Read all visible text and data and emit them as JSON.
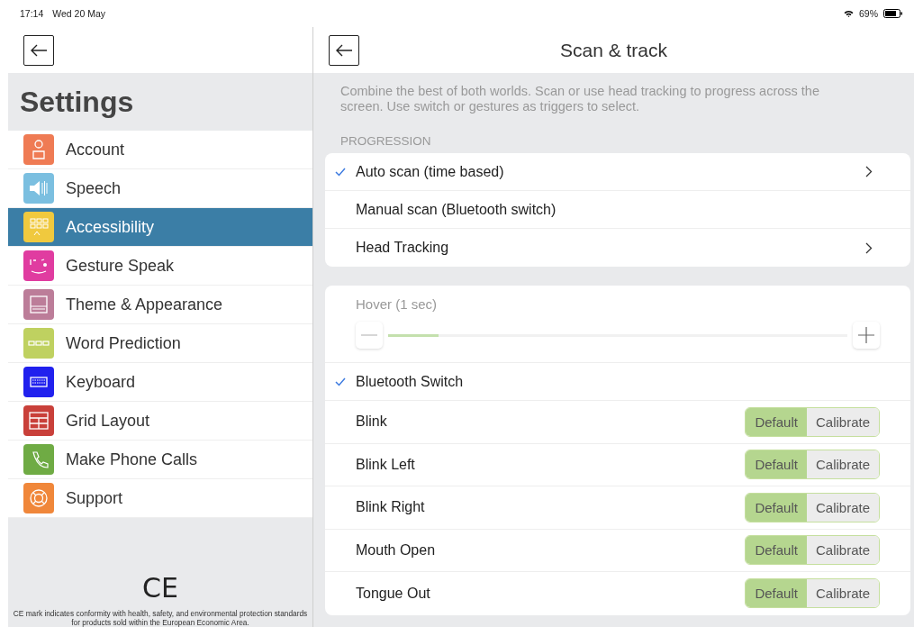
{
  "status_bar": {
    "time": "17:14",
    "date": "Wed 20 May",
    "battery": "69%"
  },
  "sidebar": {
    "title": "Settings",
    "items": [
      {
        "label": "Account",
        "color": "#ef7b54",
        "selected": false
      },
      {
        "label": "Speech",
        "color": "#7bbfe0",
        "selected": false
      },
      {
        "label": "Accessibility",
        "color": "#f0c93e",
        "selected": true
      },
      {
        "label": "Gesture Speak",
        "color": "#e03ca0",
        "selected": false
      },
      {
        "label": "Theme & Appearance",
        "color": "#bc7d99",
        "selected": false
      },
      {
        "label": "Word Prediction",
        "color": "#bfd160",
        "selected": false
      },
      {
        "label": "Keyboard",
        "color": "#2121ee",
        "selected": false
      },
      {
        "label": "Grid Layout",
        "color": "#c9403a",
        "selected": false
      },
      {
        "label": "Make Phone Calls",
        "color": "#6fab44",
        "selected": false
      },
      {
        "label": "Support",
        "color": "#f0873a",
        "selected": false
      }
    ],
    "footer": {
      "mark": "CE",
      "text": "CE mark indicates conformity with health, safety, and environmental protection standards for products sold within the European Economic Area."
    }
  },
  "page": {
    "title": "Scan & track",
    "description": "Combine the best of both worlds. Scan or use head tracking to progress across the screen. Use switch or gestures as triggers to select.",
    "progression": {
      "heading": "PROGRESSION",
      "items": [
        {
          "label": "Auto scan (time based)",
          "checked": true,
          "chevron": true
        },
        {
          "label": "Manual scan (Bluetooth switch)",
          "checked": false,
          "chevron": false
        },
        {
          "label": "Head Tracking",
          "checked": false,
          "chevron": true
        }
      ]
    },
    "hover": {
      "label": "Hover (1 sec)",
      "disabled": true,
      "level": 0.11
    },
    "triggers": [
      {
        "kind": "check",
        "label": "Bluetooth Switch",
        "checked": true
      },
      {
        "kind": "gesture",
        "label": "Blink",
        "segments": [
          {
            "label": "Default",
            "selected": true
          },
          {
            "label": "Calibrate",
            "selected": false
          }
        ]
      },
      {
        "kind": "gesture",
        "label": "Blink Left",
        "segments": [
          {
            "label": "Default",
            "selected": true
          },
          {
            "label": "Calibrate",
            "selected": false
          }
        ]
      },
      {
        "kind": "gesture",
        "label": "Blink Right",
        "segments": [
          {
            "label": "Default",
            "selected": true
          },
          {
            "label": "Calibrate",
            "selected": false
          }
        ]
      },
      {
        "kind": "gesture",
        "label": "Mouth Open",
        "segments": [
          {
            "label": "Default",
            "selected": true
          },
          {
            "label": "Calibrate",
            "selected": false
          }
        ]
      },
      {
        "kind": "gesture",
        "label": "Tongue Out",
        "segments": [
          {
            "label": "Default",
            "selected": true
          },
          {
            "label": "Calibrate",
            "selected": false
          }
        ]
      }
    ]
  }
}
